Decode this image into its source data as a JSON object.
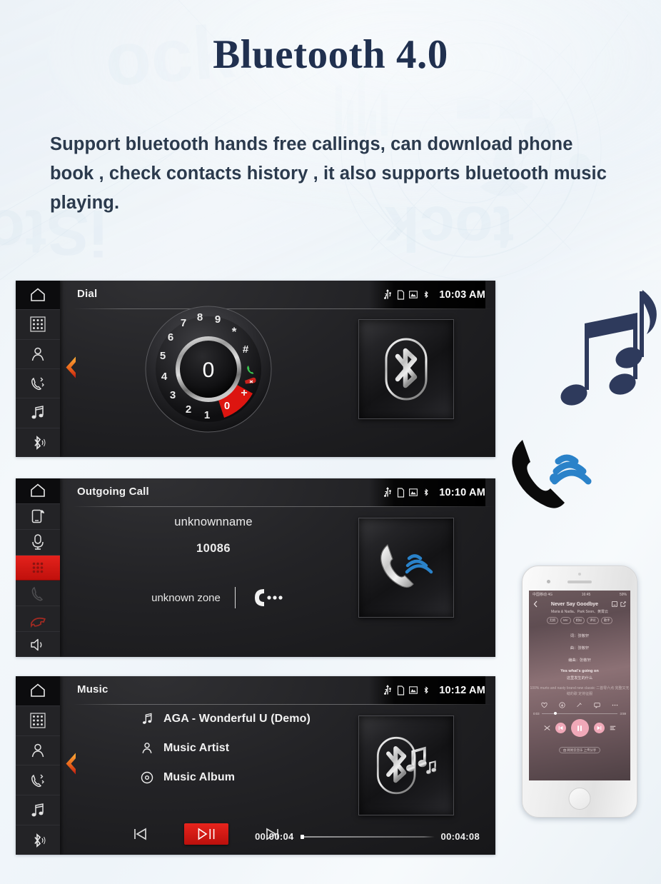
{
  "page": {
    "title": "Bluetooth 4.0",
    "subtitle": "Support bluetooth hands free callings, can download phone book , check contacts history , it also supports bluetooth music playing.",
    "colors": {
      "title": "#20304f",
      "body_text": "#2b3a4d",
      "accent_red": "#e4221c",
      "accent_blue": "#1f7fc4",
      "screen_bg": "#1b1b1d",
      "sidebar_bg": "#232326"
    }
  },
  "screens": [
    {
      "id": "dial",
      "title": "Dial",
      "clock": "10:03 AM",
      "status_icons": [
        "usb-icon",
        "sd-card-icon",
        "media-icon",
        "bluetooth-icon"
      ],
      "sidebar": [
        {
          "name": "home-icon",
          "state": "active"
        },
        {
          "name": "keypad-icon",
          "state": "normal"
        },
        {
          "name": "contacts-icon",
          "state": "normal"
        },
        {
          "name": "call-history-icon",
          "state": "normal"
        },
        {
          "name": "music-icon",
          "state": "normal"
        },
        {
          "name": "bluetooth-icon",
          "state": "normal"
        }
      ],
      "back_chevron": true,
      "big_icon": "bluetooth-icon",
      "dial": {
        "center_digit": "0",
        "keys": [
          "7",
          "8",
          "9",
          "*",
          "#",
          "call",
          "backspace",
          "+",
          "0",
          "1",
          "2",
          "3",
          "4",
          "5",
          "6"
        ],
        "highlighted_key": "0"
      }
    },
    {
      "id": "outgoing-call",
      "title": "Outgoing Call",
      "clock": "10:10 AM",
      "status_icons": [
        "usb-icon",
        "sd-card-icon",
        "media-icon",
        "bluetooth-icon"
      ],
      "sidebar": [
        {
          "name": "home-icon",
          "state": "active"
        },
        {
          "name": "phone-signal-icon",
          "state": "normal"
        },
        {
          "name": "microphone-icon",
          "state": "normal"
        },
        {
          "name": "keypad-icon",
          "state": "active-red"
        },
        {
          "name": "call-icon",
          "state": "dim"
        },
        {
          "name": "hangup-icon",
          "state": "red"
        },
        {
          "name": "speaker-icon",
          "state": "normal"
        }
      ],
      "caller_name": "unknownname",
      "caller_number": "10086",
      "caller_zone": "unknown zone",
      "dialing_icon": "phone-dialing-icon",
      "big_icon": "phone-ringing-icon"
    },
    {
      "id": "music",
      "title": "Music",
      "clock": "10:12 AM",
      "status_icons": [
        "usb-icon",
        "sd-card-icon",
        "media-icon",
        "bluetooth-icon"
      ],
      "sidebar": [
        {
          "name": "home-icon",
          "state": "active"
        },
        {
          "name": "keypad-icon",
          "state": "normal"
        },
        {
          "name": "contacts-icon",
          "state": "normal"
        },
        {
          "name": "call-history-icon",
          "state": "normal"
        },
        {
          "name": "music-icon",
          "state": "normal"
        },
        {
          "name": "bluetooth-icon",
          "state": "normal"
        }
      ],
      "back_chevron": true,
      "big_icon": "bluetooth-music-icon",
      "tracks": [
        {
          "icon": "music-note-icon",
          "label": "AGA - Wonderful U (Demo)"
        },
        {
          "icon": "artist-icon",
          "label": "Music Artist"
        },
        {
          "icon": "album-icon",
          "label": "Music Album"
        }
      ],
      "transport": {
        "previous": "previous-track-icon",
        "play_pause": "play-pause-icon",
        "next": "next-track-icon",
        "play_active": true
      },
      "progress": {
        "elapsed": "00:00:04",
        "total": "00:04:08",
        "percent": 1.6
      }
    }
  ],
  "decorations": {
    "music_notes": "music-notes-graphic",
    "phone_signal": "phone-signal-graphic"
  },
  "phone_mock": {
    "status_left": "中国移动 4G",
    "status_time": "16:45",
    "status_right": "59%",
    "song_title": "Never Say Goodbye",
    "song_artists": "Maria & Nadia、Park Soon、黄霄云",
    "tags": [
      "无损",
      "MV",
      "相似",
      "评论",
      "歌手"
    ],
    "credits": [
      "词：张敬轩",
      "曲：张敬轩",
      "编曲：张敬轩"
    ],
    "lyric_main": "Yes what's going on",
    "lyric_sub": "这里发生的什么",
    "lyric_faint": "100% murto and nasty brand new classic 二首零六点 完整又无缝的歌 定将征服",
    "seek_elapsed": "0:03",
    "seek_total": "3:59",
    "footer_note": "由 网易云音乐 上传分享"
  }
}
